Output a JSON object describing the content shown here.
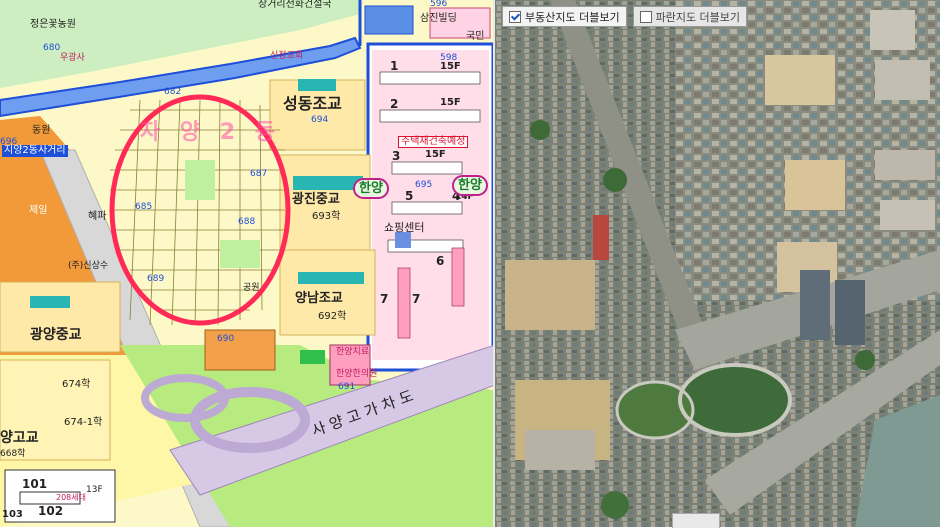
{
  "left_map": {
    "areas": {
      "sungdong": "성동조교",
      "gwangjin": "광진중교",
      "yangnam": "양남조교",
      "gwangyang": "광양중교",
      "yanggo": "양고교",
      "shopping": "쇼핑센터",
      "gongwon": "공원",
      "jaeil": "제일",
      "hyepa": "혜파",
      "sangsu": "(주)신상수"
    },
    "lots": {
      "l693": "693학",
      "l692": "692학",
      "l674": "674학",
      "l674_1": "674-1학",
      "l668": "668학",
      "l694": "694",
      "l695": "695",
      "l696": "696",
      "l680": "680",
      "l682": "682",
      "l685": "685",
      "l687": "687",
      "l688": "688",
      "l690": "690",
      "l689": "689",
      "l691": "691",
      "l596": "596",
      "l598": "598",
      "l5": "5",
      "l6": "6",
      "l7a": "7",
      "l7b": "7",
      "l1": "1",
      "l2": "2",
      "l3": "3",
      "l4": "4",
      "l101": "101",
      "l102": "102",
      "l103": "103",
      "f15": "15F",
      "f15b": "15F",
      "f15c": "15F",
      "f14": "14F",
      "f13": "13F",
      "h208": "208세대"
    },
    "roads": {
      "overpass": "사 양 고 가 차 도",
      "intersection": "지양2동사거리",
      "dong": "동원"
    },
    "badges": {
      "hanyang1": "한양",
      "hanyang2": "한양"
    },
    "pink": {
      "p1": "장거리전화건설국",
      "p2": "정은꽃농원",
      "p3": "삼진빌딩",
      "p4": "주택재건축예정",
      "p5": "국민",
      "p6": "신정교회",
      "p7": "우광사",
      "p8": "한양치료",
      "p9": "한양한의원"
    },
    "red_highlight": "자 양 2 동"
  },
  "toolbar": {
    "realestate": "부동산지도 더블보기",
    "cadastral": "파란지도 더블보기"
  }
}
